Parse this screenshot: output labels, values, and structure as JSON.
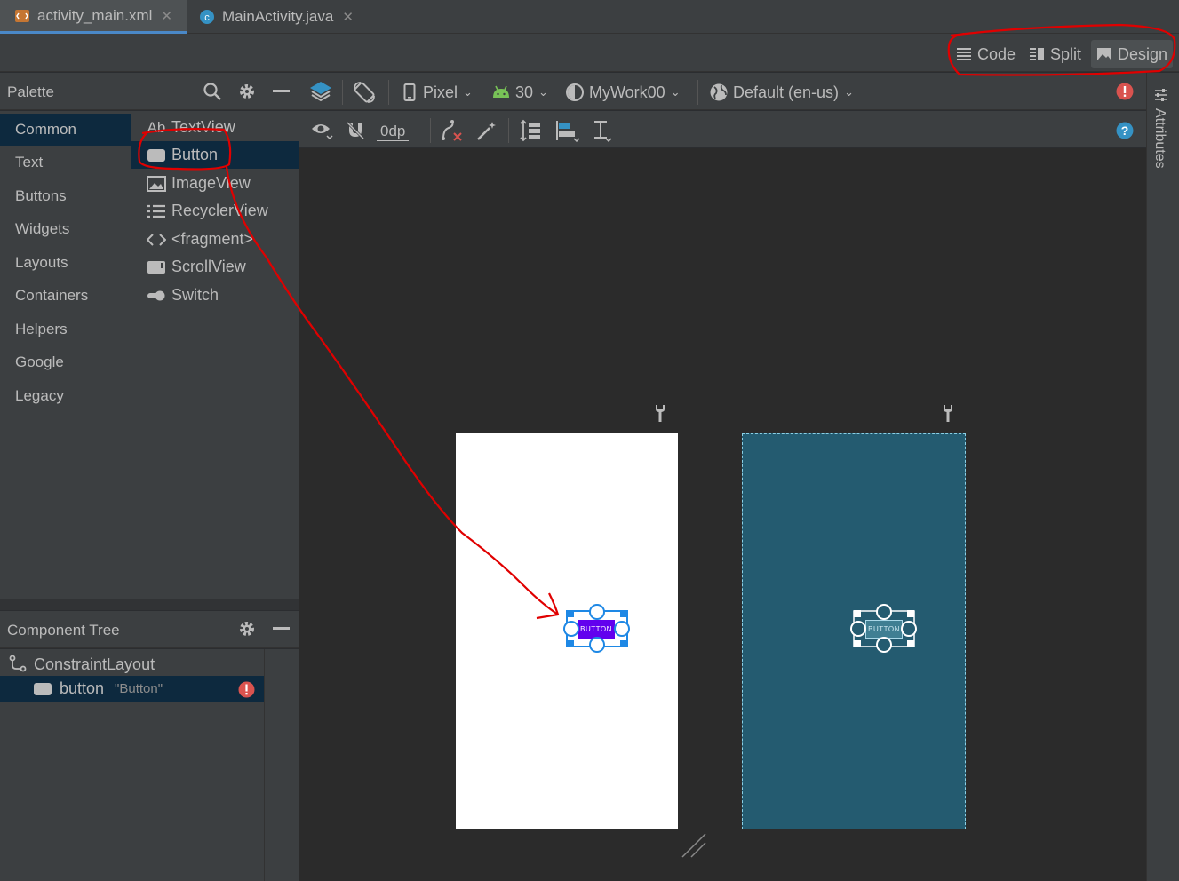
{
  "tabs": [
    {
      "label": "activity_main.xml",
      "icon": "layout-xml-icon",
      "active": true
    },
    {
      "label": "MainActivity.java",
      "icon": "java-class-icon",
      "active": false
    }
  ],
  "view_modes": {
    "code": "Code",
    "split": "Split",
    "design": "Design",
    "selected": "Design"
  },
  "palette": {
    "title": "Palette",
    "categories": [
      "Common",
      "Text",
      "Buttons",
      "Widgets",
      "Layouts",
      "Containers",
      "Helpers",
      "Google",
      "Legacy"
    ],
    "selected_category": "Common",
    "items": [
      {
        "label": "TextView",
        "icon_text": "Ab"
      },
      {
        "label": "Button"
      },
      {
        "label": "ImageView"
      },
      {
        "label": "RecyclerView"
      },
      {
        "label": "<fragment>"
      },
      {
        "label": "ScrollView"
      },
      {
        "label": "Switch"
      }
    ],
    "selected_item": "Button"
  },
  "toolbar": {
    "device": "Pixel",
    "api": "30",
    "theme": "MyWork00",
    "locale": "Default (en-us)",
    "margin": "0dp"
  },
  "component_tree": {
    "title": "Component Tree",
    "root": "ConstraintLayout",
    "child_id": "button",
    "child_text": "\"Button\""
  },
  "canvas": {
    "button_label": "BUTTON",
    "blueprint_button_label": "BUTTON"
  },
  "attributes_label": "Attributes",
  "colors": {
    "accent": "#4a88c7",
    "selection": "#0d293e",
    "error": "#d9534f",
    "annotation": "#e00000",
    "blueprint": "#245b70",
    "button": "#6200ee"
  }
}
